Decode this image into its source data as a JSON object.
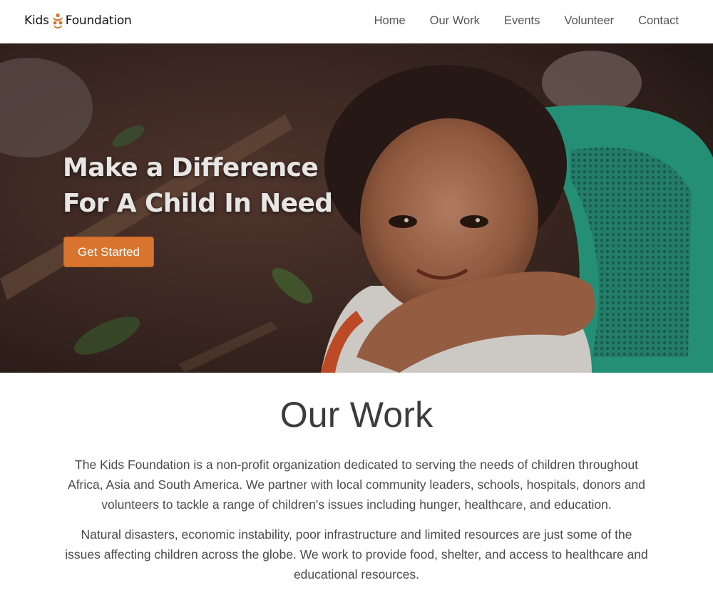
{
  "brand": {
    "name_part1": "Kids",
    "name_part2": "Foundation",
    "logo_icon": "people-logo-icon",
    "accent_color": "#d8742d"
  },
  "nav": {
    "items": [
      {
        "label": "Home"
      },
      {
        "label": "Our Work"
      },
      {
        "label": "Events"
      },
      {
        "label": "Volunteer"
      },
      {
        "label": "Contact"
      }
    ]
  },
  "hero": {
    "title_line1": "Make a Difference",
    "title_line2": "For A Child In Need",
    "cta_label": "Get Started",
    "cta_color": "#d8742d"
  },
  "our_work": {
    "title": "Our Work",
    "paragraph1": "The Kids Foundation is a non-profit organization dedicated to serving the needs of children throughout Africa, Asia and South America. We partner with local community leaders, schools, hospitals, donors and volunteers to tackle a range of children's issues including hunger, healthcare, and education.",
    "paragraph2": "Natural disasters, economic instability, poor infrastructure and limited resources are just some of the issues affecting children across the globe. We work to provide food, shelter, and access to healthcare and educational resources."
  }
}
